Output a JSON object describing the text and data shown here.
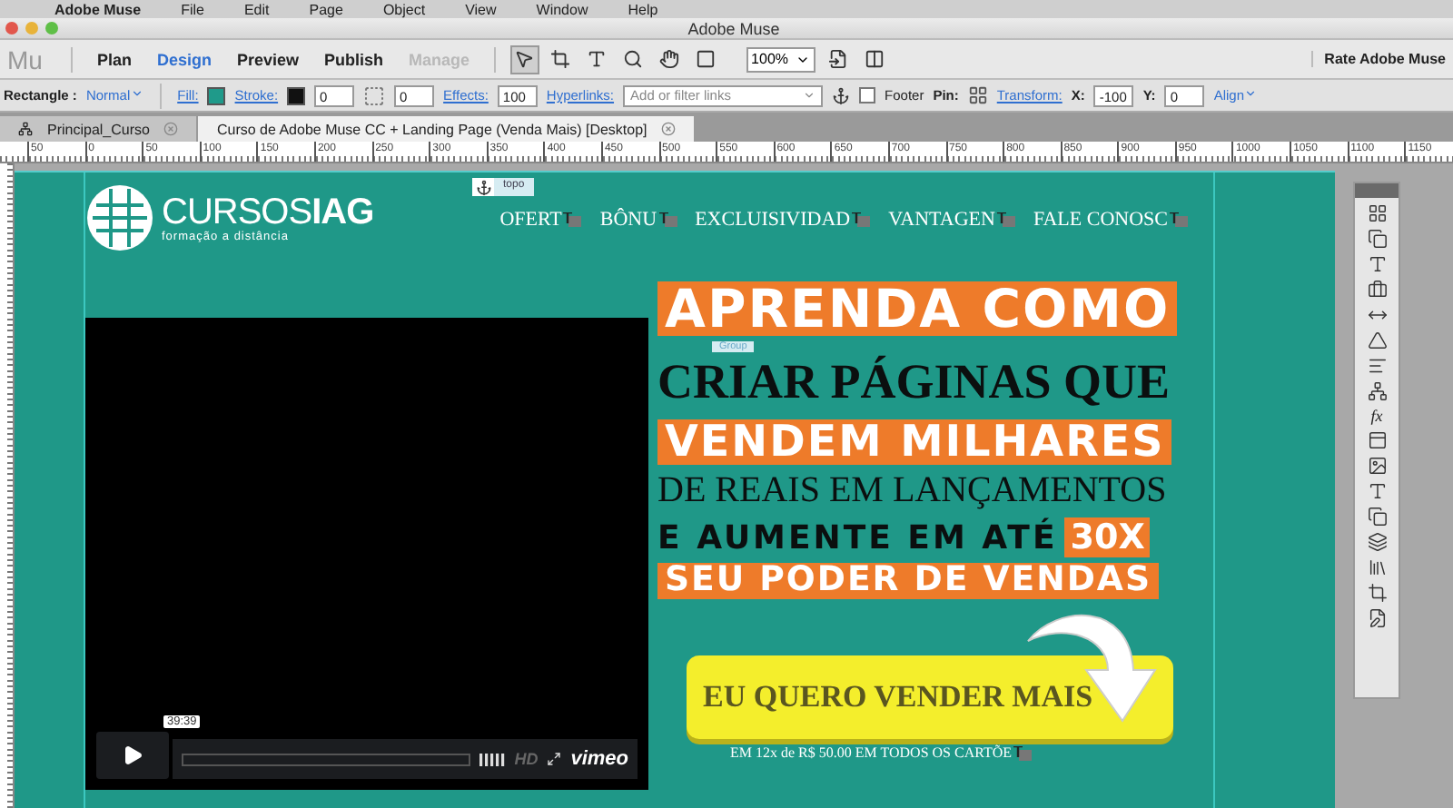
{
  "menu_bar": {
    "items": [
      "Adobe Muse",
      "File",
      "Edit",
      "Page",
      "Object",
      "View",
      "Window",
      "Help"
    ]
  },
  "window": {
    "title": "Adobe Muse"
  },
  "toolbar": {
    "app_label": "Mu",
    "modes": [
      {
        "label": "Plan",
        "selected": false,
        "disabled": false
      },
      {
        "label": "Design",
        "selected": true,
        "disabled": false
      },
      {
        "label": "Preview",
        "selected": false,
        "disabled": false
      },
      {
        "label": "Publish",
        "selected": false,
        "disabled": false
      },
      {
        "label": "Manage",
        "selected": false,
        "disabled": true
      }
    ],
    "zoom": "100%",
    "rate": "Rate Adobe Muse"
  },
  "control_bar": {
    "object_type": "Rectangle :",
    "state": "Normal",
    "fill_label": "Fill:",
    "stroke_label": "Stroke:",
    "stroke_value": "0",
    "corner_value": "0",
    "effects_label": "Effects:",
    "opacity": "100",
    "hyperlinks_label": "Hyperlinks:",
    "links_placeholder": "Add or filter links",
    "footer": {
      "label": "Footer",
      "checked": false
    },
    "pin_label": "Pin:",
    "transform_label": "Transform:",
    "x_label": "X:",
    "x_value": "-100",
    "y_label": "Y:",
    "y_value": "0",
    "align": "Align"
  },
  "tabs": [
    {
      "label": "Principal_Curso",
      "selected": false
    },
    {
      "label": "Curso de Adobe Muse CC + Landing Page (Venda Mais) [Desktop]",
      "selected": true
    }
  ],
  "ruler": {
    "labels": [
      "50",
      "0",
      "50",
      "100",
      "150",
      "200",
      "250",
      "300",
      "350",
      "400",
      "450",
      "500",
      "550",
      "600",
      "650",
      "700",
      "750",
      "800",
      "850",
      "900",
      "950",
      "1000",
      "1050",
      "1100",
      "1150"
    ]
  },
  "page": {
    "anchor_label": "topo",
    "group_label": "Group",
    "logo": {
      "name": "CURSOS**IAG**",
      "tagline": "formação a distância"
    },
    "nav": [
      "OFERT",
      "BÔNU",
      "EXCLUISIVIDAD",
      "VANTAGEN",
      "FALE CONOSC"
    ],
    "video": {
      "time": "39:39",
      "quality": "HD",
      "brand": "vimeo"
    },
    "headline": [
      [
        {
          "text": "APRENDA COMO",
          "kind": "highlight"
        }
      ],
      [
        {
          "text": "CRIAR PÁGINAS QUE",
          "kind": "serif"
        }
      ],
      [
        {
          "text": "VENDEM MILHARES",
          "kind": "highlight"
        }
      ],
      [
        {
          "text": "DE REAIS EM LANÇAMENTOS",
          "kind": "light"
        }
      ],
      [
        {
          "text": "E AUMENTE EM ATÉ",
          "kind": "heavy"
        },
        {
          "text": "30X",
          "kind": "highlight_small"
        }
      ],
      [
        {
          "text": "SEU PODER DE VENDAS",
          "kind": "highlight"
        }
      ]
    ],
    "cta": {
      "label": "EU QUERO VENDER MAIS",
      "note": "EM 12x de R$ 50.00 EM TODOS OS CARTÕE"
    }
  },
  "panel": {
    "fx_label": "fx"
  }
}
